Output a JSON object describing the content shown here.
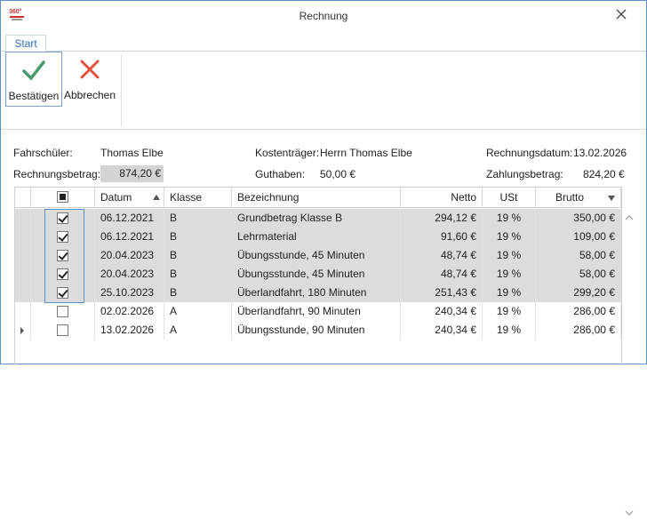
{
  "window": {
    "title": "Rechnung",
    "logo_text": "360°"
  },
  "ribbon": {
    "tab_start": "Start",
    "confirm_label": "Bestätigen",
    "cancel_label": "Abbrechen"
  },
  "info": {
    "student_label": "Fahrschüler:",
    "student_value": "Thomas Elbe",
    "payer_label": "Kostenträger:",
    "payer_value": "Herrn Thomas Elbe",
    "invoice_date_label": "Rechnungsdatum:",
    "invoice_date_value": "13.02.2026",
    "invoice_amount_label": "Rechnungsbetrag:",
    "invoice_amount_value": "874,20 €",
    "credit_label": "Guthaben:",
    "credit_value": "50,00 €",
    "payment_amount_label": "Zahlungsbetrag:",
    "payment_amount_value": "824,20 €"
  },
  "grid": {
    "headers": {
      "date": "Datum",
      "class": "Klasse",
      "description": "Bezeichnung",
      "net": "Netto",
      "vat": "USt",
      "gross": "Brutto"
    },
    "rows": [
      {
        "checked": true,
        "selected": true,
        "date": "06.12.2021",
        "class": "B",
        "description": "Grundbetrag Klasse B",
        "net": "294,12 €",
        "vat": "19 %",
        "gross": "350,00 €"
      },
      {
        "checked": true,
        "selected": true,
        "date": "06.12.2021",
        "class": "B",
        "description": "Lehrmaterial",
        "net": "91,60 €",
        "vat": "19 %",
        "gross": "109,00 €"
      },
      {
        "checked": true,
        "selected": true,
        "date": "20.04.2023",
        "class": "B",
        "description": "Übungsstunde, 45 Minuten",
        "net": "48,74 €",
        "vat": "19 %",
        "gross": "58,00 €"
      },
      {
        "checked": true,
        "selected": true,
        "date": "20.04.2023",
        "class": "B",
        "description": "Übungsstunde, 45 Minuten",
        "net": "48,74 €",
        "vat": "19 %",
        "gross": "58,00 €"
      },
      {
        "checked": true,
        "selected": true,
        "date": "25.10.2023",
        "class": "B",
        "description": "Überlandfahrt, 180 Minuten",
        "net": "251,43 €",
        "vat": "19 %",
        "gross": "299,20 €"
      },
      {
        "checked": false,
        "selected": false,
        "date": "02.02.2026",
        "class": "A",
        "description": "Überlandfahrt, 90 Minuten",
        "net": "240,34 €",
        "vat": "19 %",
        "gross": "286,00 €"
      },
      {
        "checked": false,
        "selected": false,
        "date": "13.02.2026",
        "class": "A",
        "description": "Übungsstunde, 90 Minuten",
        "net": "240,34 €",
        "vat": "19 %",
        "gross": "286,00 €"
      }
    ]
  },
  "colors": {
    "accent": "#2f6db5",
    "confirm": "#4a9a6e",
    "cancel": "#e0503a",
    "selected_row": "#dcdcdc"
  }
}
